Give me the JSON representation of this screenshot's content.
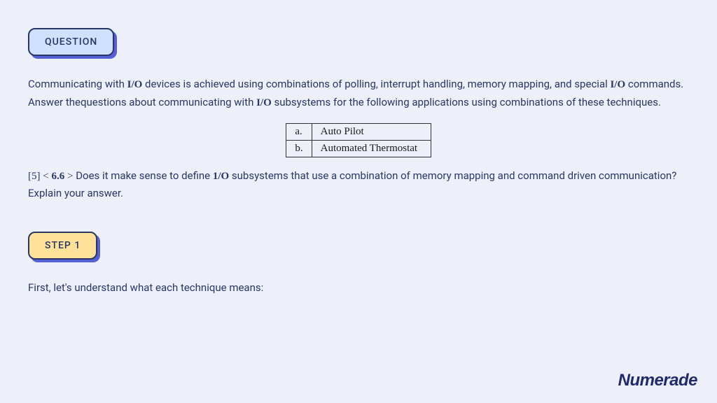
{
  "badges": {
    "question": "QUESTION",
    "step1": "STEP 1"
  },
  "question": {
    "intro_pre": "Communicating with ",
    "io1": "I/O",
    "intro_mid1": " devices is achieved using combinations of polling, interrupt handling, memory mapping, and special ",
    "io2": "I/O",
    "intro_mid2": " commands. Answer thequestions about communicating with ",
    "io3": "I/O",
    "intro_post": " subsystems for the following applications using combinations of these techniques.",
    "table": {
      "rows": [
        {
          "label": "a.",
          "value": "Auto Pilot"
        },
        {
          "label": "b.",
          "value": "Automated Thermostat"
        }
      ]
    },
    "second_pre": "[5]",
    "second_lt": " < ",
    "second_num": "6.6",
    "second_gt": " > ",
    "second_mid1": "Does it make sense to define ",
    "one_o": "1/O",
    "second_post": " subsystems that use a combination of memory mapping and command driven communication? Explain your answer."
  },
  "step1_text": "First, let's understand what each technique means:",
  "brand": "Numerade"
}
